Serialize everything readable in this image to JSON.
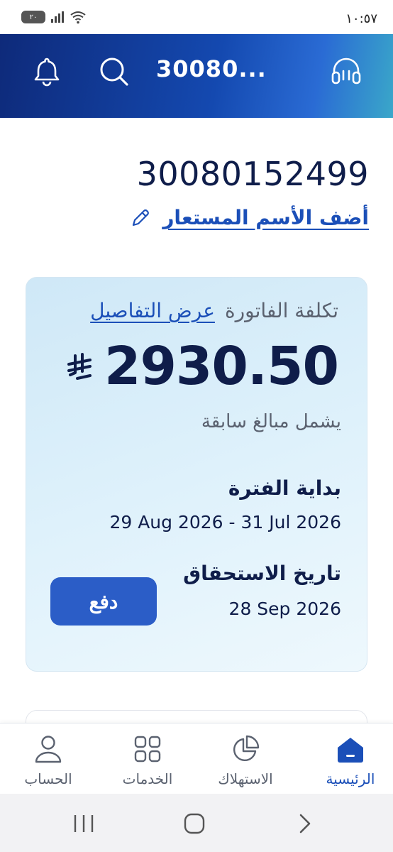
{
  "status_bar": {
    "time": "١٠:٥٧",
    "battery": "٢٠"
  },
  "header": {
    "title": "30080...",
    "icons": [
      "bell-icon",
      "search-icon",
      "headset-icon"
    ]
  },
  "account": {
    "number": "30080152499",
    "add_nickname": "أضف الأسم المستعار"
  },
  "bill": {
    "cost_label": "تكلفة الفاتورة",
    "view_details": "عرض التفاصيل",
    "amount": "2930.50",
    "currency_icon": "saudi-riyal-icon",
    "includes_note": "يشمل مبالغ سابقة",
    "period_label": "بداية الفترة",
    "period_value": "29 Aug 2026 - 31 Jul 2026",
    "due_label": "تاريخ الاستحقاق",
    "due_value": "28 Sep 2026",
    "pay_label": "دفع"
  },
  "nav": {
    "home": "الرئيسية",
    "consumption": "الاستهلاك",
    "services": "الخدمات",
    "account": "الحساب"
  },
  "colors": {
    "primary": "#1b4fb8",
    "dark_text": "#0f1d4a",
    "pay_button": "#2b5dc7",
    "muted": "#5b6270"
  }
}
